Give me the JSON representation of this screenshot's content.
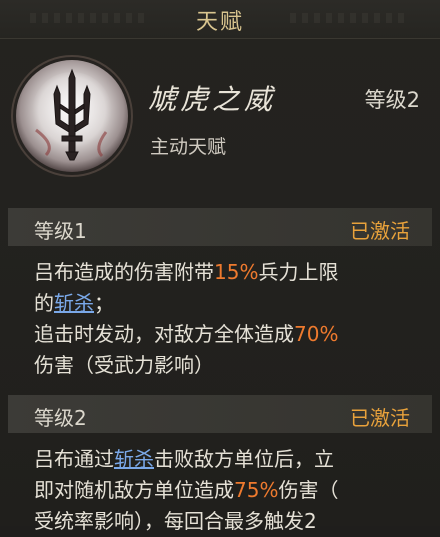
{
  "header": {
    "title": "天赋"
  },
  "skill": {
    "name": "虓虎之威",
    "level": "等级2",
    "type": "主动天赋",
    "icon": "trident-emblem-icon"
  },
  "levels": [
    {
      "label": "等级1",
      "status": "已激活",
      "lines": [
        {
          "a": "吕布造成的伤害附带",
          "b": "15%",
          "c": "兵力上限"
        },
        {
          "a": "的",
          "b": "斩杀",
          "c": "；"
        },
        {
          "a": "追击时发动，对敌方全体造成",
          "b": "70%"
        },
        {
          "a": "伤害（受武力影响）"
        }
      ]
    },
    {
      "label": "等级2",
      "status": "已激活",
      "lines": [
        {
          "a": "吕布通过",
          "b": "斩杀",
          "c": "击败敌方单位后，立"
        },
        {
          "a": "即对随机敌方单位造成",
          "b": "75%",
          "c": "伤害（"
        },
        {
          "a": "受统率影响），每回合最多触发2"
        }
      ]
    }
  ],
  "colors": {
    "title_gold": "#d9c58f",
    "status_orange": "#e9a23b",
    "value_orange": "#ee7a2e",
    "link_blue": "#7aa8e8"
  }
}
